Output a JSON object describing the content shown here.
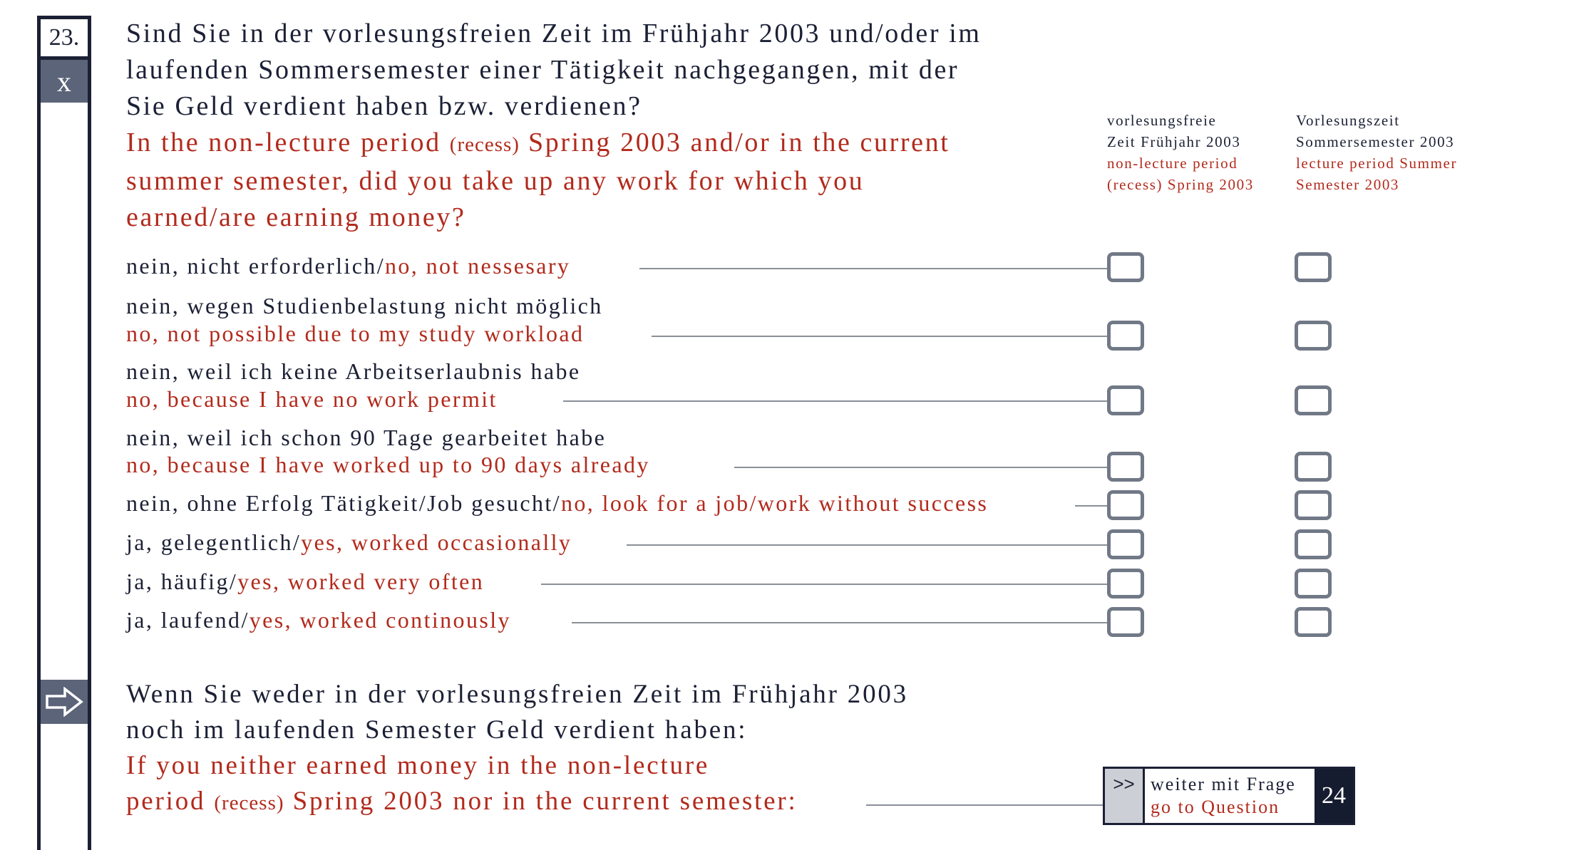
{
  "question": {
    "number": "23.",
    "mark": "x",
    "de_lines": [
      "Sind Sie in der vorlesungsfreien Zeit im Frühjahr 2003 und/oder im",
      "laufenden Sommersemester einer Tätigkeit nachgegangen, mit der",
      "Sie Geld verdient haben bzw. verdienen?"
    ],
    "en_line1_a": "In the non-lecture period ",
    "en_line1_b": "(recess)",
    "en_line1_c": " Spring 2003 and/or in the current",
    "en_line2": "summer semester, did you take up any work for which you",
    "en_line3": "earned/are earning money?"
  },
  "columns": [
    {
      "de1": "vorlesungsfreie",
      "de2": "Zeit Frühjahr 2003",
      "en1": "non-lecture period",
      "en2": "(recess) Spring 2003"
    },
    {
      "de1": "Vorlesungszeit",
      "de2": "Sommersemester 2003",
      "en1": "lecture period Summer",
      "en2": "Semester 2003"
    }
  ],
  "options": [
    {
      "de": "nein, nicht erforderlich/",
      "en": "no, not nessesary"
    },
    {
      "de": "nein, wegen Studienbelastung nicht möglich",
      "en": "no, not possible due to my study workload"
    },
    {
      "de": "nein, weil ich keine Arbeitserlaubnis habe",
      "en": "no, because I have no work permit"
    },
    {
      "de": "nein, weil ich schon 90 Tage gearbeitet habe",
      "en": "no, because I have worked up to 90 days already"
    },
    {
      "de": "nein, ohne Erfolg Tätigkeit/Job gesucht/",
      "en": "no, look for a job/work without success"
    },
    {
      "de": "ja, gelegentlich/",
      "en": "yes, worked occasionally"
    },
    {
      "de": "ja, häufig/",
      "en": "yes, worked very often"
    },
    {
      "de": "ja, laufend/",
      "en": "yes, worked continously"
    }
  ],
  "filter": {
    "de1": "Wenn Sie weder in der vorlesungsfreien Zeit im Frühjahr 2003",
    "de2": "noch im laufenden Semester Geld verdient haben:",
    "en1": "If you neither earned money in the non-lecture",
    "en2a": "period ",
    "en2b": "(recess)",
    "en2c": " Spring 2003 nor in the current semester:",
    "goto_chevron": ">>",
    "goto_de": "weiter mit Frage",
    "goto_en": "go to Question",
    "goto_num": "24"
  }
}
